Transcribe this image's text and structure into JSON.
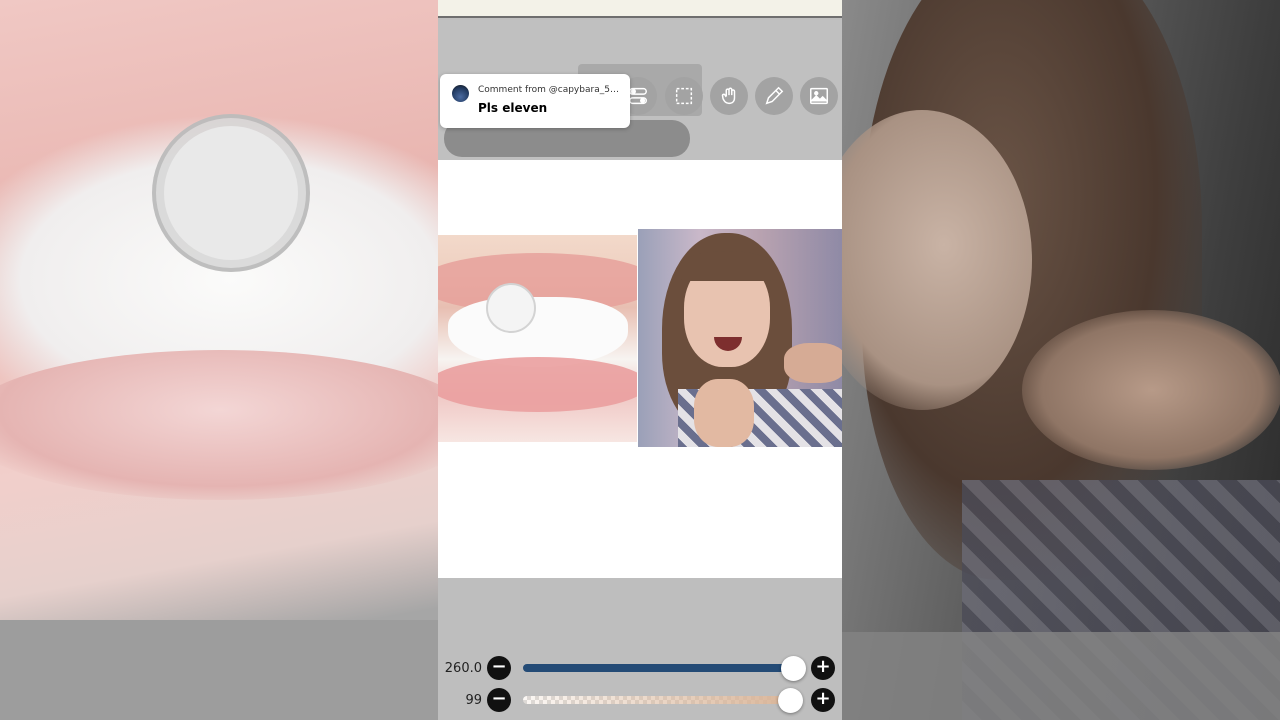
{
  "notification": {
    "from": "Comment from @capybara_55...",
    "message": "Pls eleven"
  },
  "toolbar": {
    "buttons": [
      {
        "icon": "back-arrow-icon"
      },
      {
        "icon": "undo-icon"
      },
      {
        "icon": "toggle-icon"
      },
      {
        "icon": "selection-icon"
      },
      {
        "icon": "hand-gesture-icon"
      },
      {
        "icon": "pen-icon"
      },
      {
        "icon": "image-icon"
      }
    ]
  },
  "sliders": {
    "size": {
      "label": "260.0",
      "value_fraction": 0.98,
      "color": "#244b76"
    },
    "opacity": {
      "label": "99",
      "value_fraction": 0.97,
      "color": "#d9b497"
    }
  },
  "colors": {
    "panel_bg": "#bebebe",
    "canvas_bg": "#ffffff",
    "accent": "#244b76"
  }
}
